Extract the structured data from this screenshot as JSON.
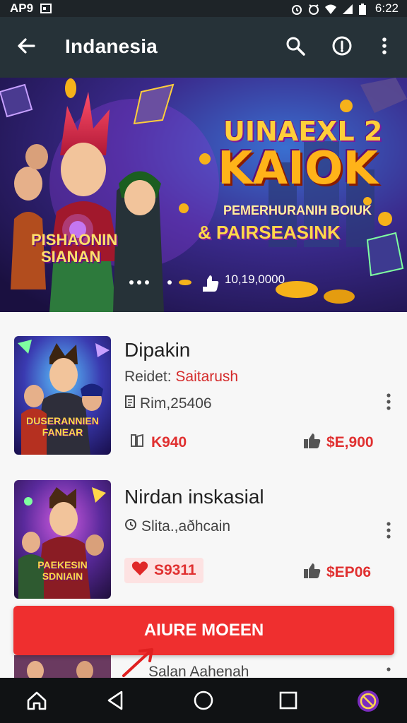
{
  "status_bar": {
    "app_label": "AP9",
    "time": "6:22"
  },
  "app_bar": {
    "title": "Indanesia",
    "icons": [
      "back-arrow-icon",
      "search-icon",
      "info-icon",
      "more-vert-icon"
    ]
  },
  "banner": {
    "title_line1": "UINAEXL 2",
    "title_line2": "KAIOK",
    "subtitle_line1": "PEMERHURANIH BOIUK",
    "subtitle_line2": "& PAIRSEASINK",
    "badge_line1": "PISHAONIN",
    "badge_line2": "SIANAN",
    "count": "10,19,0000"
  },
  "list": {
    "items": [
      {
        "name": "Dipakin",
        "meta1_prefix": "Reidet:",
        "meta1_value": "Saitarush",
        "meta2": "Rim,25406",
        "thumb_text_line1": "DUSERANNIEN",
        "thumb_text_line2": "FANEAR",
        "stat_left": "K940",
        "stat_right": "$E,900"
      },
      {
        "name": "Nirdan inskasial",
        "meta1": "Slita.,aðhcain",
        "thumb_text_line1": "PAEKESIN",
        "thumb_text_line2": "SDNIAIN",
        "stat_left": "S9311",
        "stat_right": "$EP06"
      }
    ],
    "partial_item_meta": "Salan Aahenah"
  },
  "cta": {
    "label": "AIURE MOEEN"
  },
  "colors": {
    "app_bar": "#263238",
    "accent_red": "#ef2f2f",
    "nav_bar": "#101214",
    "purple_accent": "#7b2cbf"
  }
}
